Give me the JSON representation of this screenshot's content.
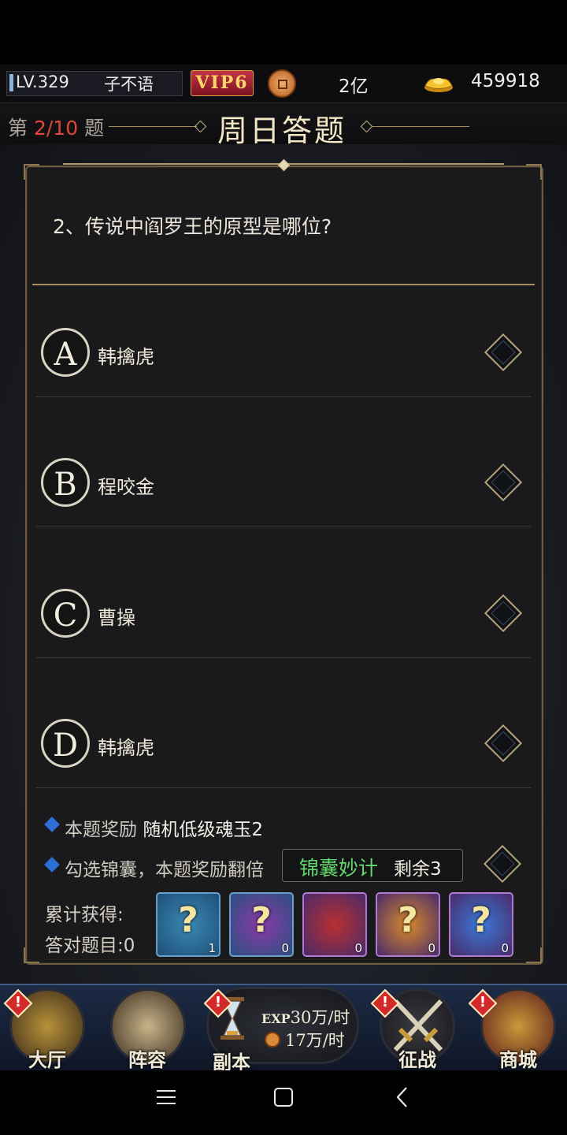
{
  "header": {
    "level": "LV.329",
    "player_name": "子不语",
    "vip": "VIP6",
    "copper": "2亿",
    "gold": "459918"
  },
  "quiz": {
    "count_prefix": "第",
    "count_current": "2/10",
    "count_suffix": "题",
    "title": "周日答题",
    "question": "2、传说中阎罗王的原型是哪位?",
    "options": [
      {
        "letter": "A",
        "text": "韩擒虎"
      },
      {
        "letter": "B",
        "text": "程咬金"
      },
      {
        "letter": "C",
        "text": "曹操"
      },
      {
        "letter": "D",
        "text": "韩擒虎"
      }
    ]
  },
  "reward": {
    "label": "本题奖励",
    "value": "随机低级魂玉2",
    "tip": "勾选锦囊，本题奖励翻倍",
    "jinnang_label": "锦囊妙计",
    "remaining": "剩余3",
    "cumulative_label": "累计获得:",
    "correct_label": "答对题目:0",
    "items": [
      {
        "icon": "jade-pendant-icon",
        "count": "1",
        "bg": "#1f4f7a"
      },
      {
        "icon": "lucky-bag-icon",
        "count": "0",
        "bg": "#2a4f80"
      },
      {
        "icon": "treasure-chest-icon",
        "count": "0",
        "bg": "#4a2a6a"
      },
      {
        "icon": "crystal-cluster-icon",
        "count": "0",
        "bg": "#4a2a6a"
      },
      {
        "icon": "gem-sack-icon",
        "count": "0",
        "bg": "#4a2a6a"
      }
    ]
  },
  "nav": {
    "hall": "大厅",
    "lineup": "阵容",
    "dungeon": "副本",
    "exp_rate": "30万/时",
    "exp_label": "EXP",
    "coin_rate": "17万/时",
    "battle": "征战",
    "shop": "商城",
    "alert_mark": "!"
  }
}
